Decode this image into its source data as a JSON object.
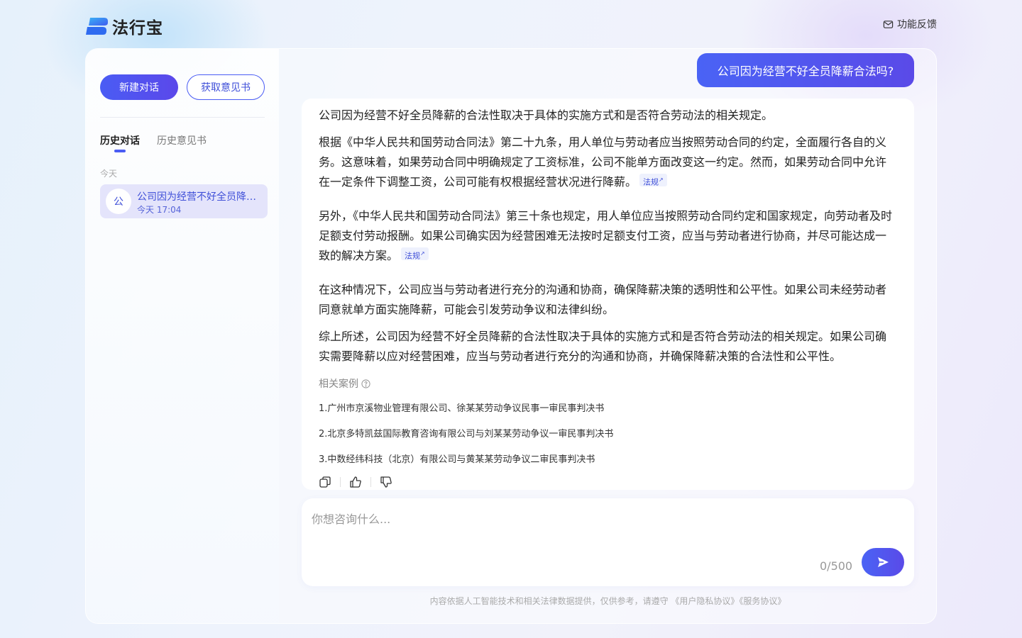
{
  "brand": {
    "name": "法行宝"
  },
  "header": {
    "feedback_label": "功能反馈"
  },
  "sidebar": {
    "new_chat_label": "新建对话",
    "get_opinion_label": "获取意见书",
    "tabs": [
      {
        "label": "历史对话"
      },
      {
        "label": "历史意见书"
      }
    ],
    "group_label": "今天",
    "history": [
      {
        "avatar": "公",
        "title": "公司因为经营不好全员降薪合法吗?",
        "time": "今天 17:04"
      }
    ]
  },
  "chat": {
    "user_message": "公司因为经营不好全员降薪合法吗?",
    "answer": {
      "p1": "公司因为经营不好全员降薪的合法性取决于具体的实施方式和是否符合劳动法的相关规定。",
      "p2": "根据《中华人民共和国劳动合同法》第二十九条，用人单位与劳动者应当按照劳动合同的约定，全面履行各自的义务。这意味着，如果劳动合同中明确规定了工资标准，公司不能单方面改变这一约定。然而，如果劳动合同中允许在一定条件下调整工资，公司可能有权根据经营状况进行降薪。",
      "p3": "另外，《中华人民共和国劳动合同法》第三十条也规定，用人单位应当按照劳动合同约定和国家规定，向劳动者及时足额支付劳动报酬。如果公司确实因为经营困难无法按时足额支付工资，应当与劳动者进行协商，并尽可能达成一致的解决方案。",
      "p4": "在这种情况下，公司应当与劳动者进行充分的沟通和协商，确保降薪决策的透明性和公平性。如果公司未经劳动者同意就单方面实施降薪，可能会引发劳动争议和法律纠纷。",
      "p5": "综上所述，公司因为经营不好全员降薪的合法性取决于具体的实施方式和是否符合劳动法的相关规定。如果公司确实需要降薪以应对经营困难，应当与劳动者进行充分的沟通和协商，并确保降薪决策的合法性和公平性。",
      "law_tag": "法规",
      "law_tag_arrow": "↗"
    },
    "cases_title": "相关案例",
    "cases": [
      "1.广州市京溪物业管理有限公司、徐某某劳动争议民事一审民事判决书",
      "2.北京多特凯兹国际教育咨询有限公司与刘某某劳动争议一审民事判决书",
      "3.中数经纬科技（北京）有限公司与黄某某劳动争议二审民事判决书"
    ]
  },
  "input": {
    "placeholder": "你想咨询什么...",
    "counter": "0/500"
  },
  "footer": {
    "disclaimer_text": "内容依据人工智能技术和相关法律数据提供，仅供参考，请遵守",
    "privacy_link": "《用户隐私协议》",
    "service_link": "《服务协议》"
  },
  "colors": {
    "accent": "#4a5cf4",
    "accent_dark": "#3f4fd8",
    "history_bg": "#e4e4fb"
  }
}
